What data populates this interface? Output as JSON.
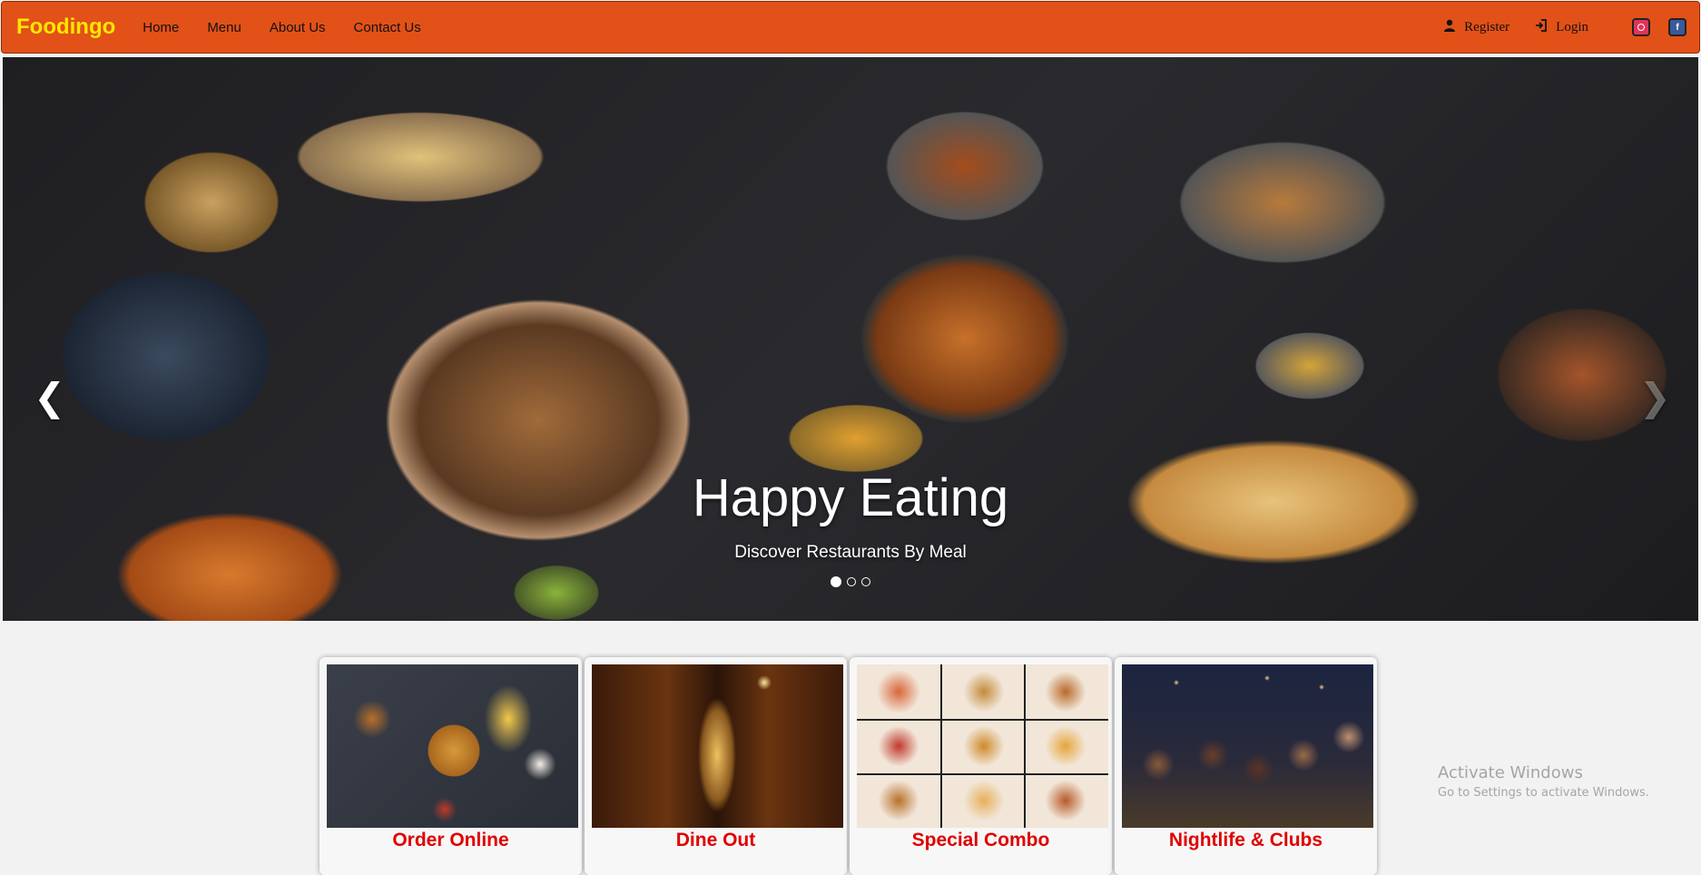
{
  "brand": "Foodingo",
  "nav": {
    "links": [
      "Home",
      "Menu",
      "About Us",
      "Contact Us"
    ],
    "register_label": "Register",
    "login_label": "Login"
  },
  "hero": {
    "title": "Happy Eating",
    "subtitle": "Discover Restaurants By Meal",
    "slide_count": 3,
    "active_slide": 1
  },
  "cards": [
    {
      "title": "Order Online",
      "image": "fast-food-assortment"
    },
    {
      "title": "Dine Out",
      "image": "restaurant-interior"
    },
    {
      "title": "Special Combo",
      "image": "combo-food-grid"
    },
    {
      "title": "Nightlife & Clubs",
      "image": "friends-at-bar"
    }
  ],
  "watermark": {
    "title": "Activate Windows",
    "subtitle": "Go to Settings to activate Windows."
  },
  "colors": {
    "navbar": "#e25117",
    "brand": "#ffe600",
    "card_title": "#e00000"
  }
}
